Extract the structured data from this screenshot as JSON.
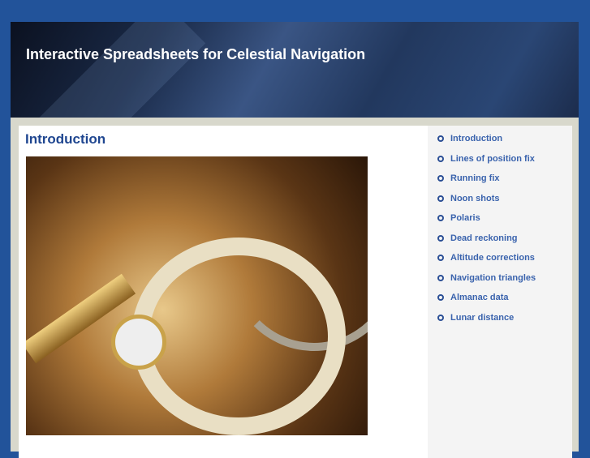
{
  "header": {
    "title": "Interactive Spreadsheets for Celestial Navigation"
  },
  "main": {
    "heading": "Introduction"
  },
  "sidebar": {
    "items": [
      {
        "label": "Introduction"
      },
      {
        "label": "Lines of position fix"
      },
      {
        "label": "Running fix"
      },
      {
        "label": "Noon shots"
      },
      {
        "label": "Polaris"
      },
      {
        "label": "Dead reckoning"
      },
      {
        "label": "Altitude corrections"
      },
      {
        "label": "Navigation triangles"
      },
      {
        "label": "Almanac data"
      },
      {
        "label": "Lunar distance"
      }
    ]
  }
}
